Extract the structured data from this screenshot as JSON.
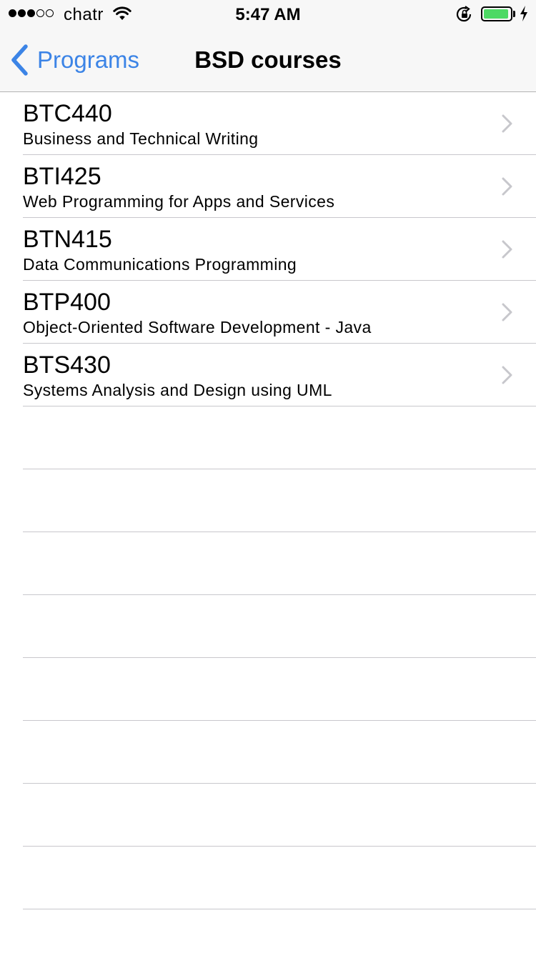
{
  "status_bar": {
    "signal_bars_filled": 3,
    "signal_bars_total": 5,
    "carrier": "chatr",
    "time": "5:47 AM",
    "battery_level": 0.95,
    "battery_color": "#4cd964",
    "icons": [
      "wifi-icon",
      "rotation-lock-icon",
      "battery-icon",
      "charging-bolt-icon"
    ]
  },
  "nav": {
    "back_label": "Programs",
    "title": "BSD courses",
    "accent_color": "#3c84e6"
  },
  "courses": [
    {
      "code": "BTC440",
      "name": "Business and Technical Writing"
    },
    {
      "code": "BTI425",
      "name": "Web Programming for Apps and Services"
    },
    {
      "code": "BTN415",
      "name": "Data Communications Programming"
    },
    {
      "code": "BTP400",
      "name": "Object-Oriented Software Development - Java"
    },
    {
      "code": "BTS430",
      "name": "Systems Analysis and Design using UML"
    }
  ]
}
